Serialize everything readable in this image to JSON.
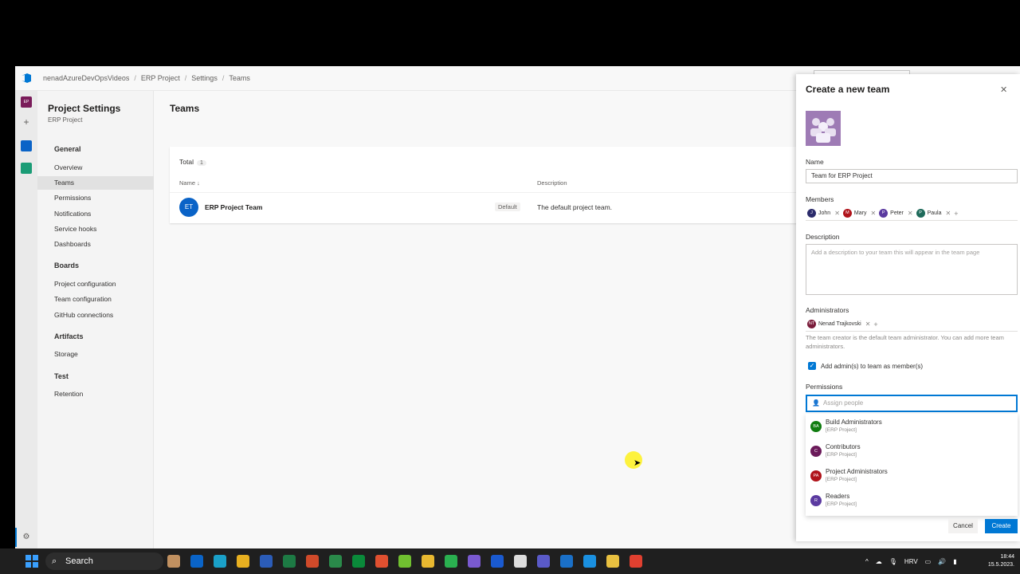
{
  "breadcrumb": [
    "nenadAzureDevOpsVideos",
    "ERP Project",
    "Settings",
    "Teams"
  ],
  "rail": {
    "project_initials": "EP"
  },
  "sidebar": {
    "title": "Project Settings",
    "subtitle": "ERP Project",
    "groups": [
      {
        "label": "General",
        "items": [
          "Overview",
          "Teams",
          "Permissions",
          "Notifications",
          "Service hooks",
          "Dashboards"
        ]
      },
      {
        "label": "Boards",
        "items": [
          "Project configuration",
          "Team configuration",
          "GitHub connections"
        ]
      },
      {
        "label": "Artifacts",
        "items": [
          "Storage"
        ]
      },
      {
        "label": "Test",
        "items": [
          "Retention"
        ]
      }
    ],
    "active_item": "Teams"
  },
  "main": {
    "heading": "Teams",
    "total_label": "Total",
    "total_count": "1",
    "col_name": "Name ↓",
    "col_description": "Description",
    "row": {
      "initials": "ET",
      "name": "ERP Project Team",
      "badge": "Default",
      "description": "The default project team."
    }
  },
  "panel": {
    "title": "Create a new team",
    "name_label": "Name",
    "name_value": "Team for ERP Project",
    "members_label": "Members",
    "members": [
      {
        "initial": "J",
        "name": "John",
        "color": "#2b2b6b"
      },
      {
        "initial": "M",
        "name": "Mary",
        "color": "#b0141b"
      },
      {
        "initial": "P",
        "name": "Peter",
        "color": "#5b3aa0"
      },
      {
        "initial": "P",
        "name": "Paula",
        "color": "#1e6a5a"
      }
    ],
    "description_label": "Description",
    "description_placeholder": "Add a description to your team this will appear in the team page",
    "admins_label": "Administrators",
    "admins": [
      {
        "initial": "NT",
        "name": "Nenad Trajkovski",
        "color": "#7a1c3a"
      }
    ],
    "admin_note": "The team creator is the default team administrator. You can add more team administrators.",
    "checkbox_label": "Add admin(s) to team as member(s)",
    "permissions_label": "Permissions",
    "permissions_placeholder": "Assign people",
    "options": [
      {
        "initials": "BA",
        "name": "Build Administrators",
        "scope": "[ERP Project]",
        "color": "#107c10"
      },
      {
        "initials": "C",
        "name": "Contributors",
        "scope": "[ERP Project]",
        "color": "#6b1a5a"
      },
      {
        "initials": "PA",
        "name": "Project Administrators",
        "scope": "[ERP Project]",
        "color": "#b0141b"
      },
      {
        "initials": "R",
        "name": "Readers",
        "scope": "[ERP Project]",
        "color": "#5b3aa0"
      }
    ],
    "cancel_label": "Cancel",
    "create_label": "Create"
  },
  "taskbar": {
    "search_label": "Search",
    "language": "HRV",
    "time": "18:44",
    "date": "15.5.2023."
  }
}
